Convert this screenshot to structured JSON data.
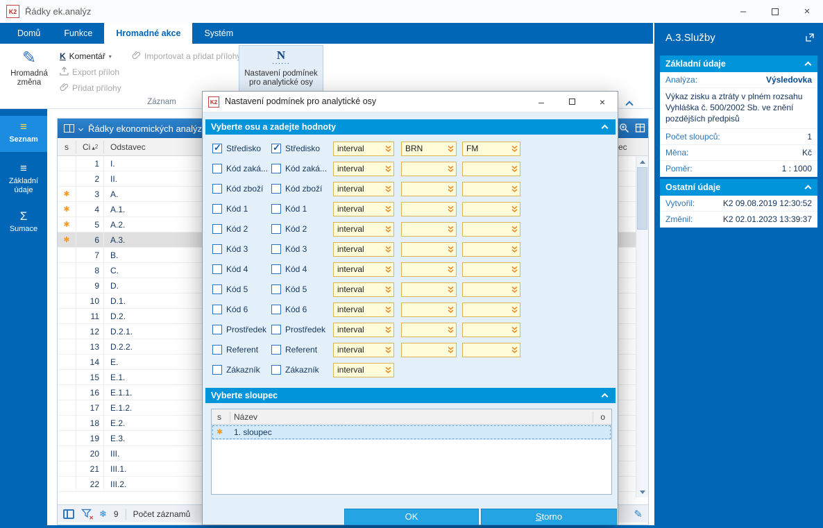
{
  "colors": {
    "accent_blue": "#0066b5",
    "section_header_blue": "#0094db",
    "field_yellow": "#fffcd9",
    "flag_orange": "#f59a23",
    "selection_gray": "#e0e0e0"
  },
  "window_controls": {
    "minimize": "–",
    "close": "×"
  },
  "titlebar": {
    "app_icon": "K2",
    "title": "Řádky ek.analýz"
  },
  "ribbon": {
    "tabs": [
      {
        "label": "Domů",
        "active": false
      },
      {
        "label": "Funkce",
        "active": false
      },
      {
        "label": "Hromadné akce",
        "active": true
      },
      {
        "label": "Systém",
        "active": false
      }
    ],
    "bulk_change_label": "Hromadná změna",
    "comment_key": "K",
    "comment_label": "Komentář",
    "export_attachments_label": "Export příloh",
    "add_attachments_label": "Přidat přílohy",
    "import_attachments_label": "Importovat a přidat přílohy",
    "axis_settings_icon": "N",
    "axis_settings_label": "Nastavení podmínek pro analytické osy",
    "group_label": "Záznam"
  },
  "sidebar": {
    "items": [
      {
        "label": "Seznam",
        "icon": "list",
        "active": true
      },
      {
        "label": "Základní údaje",
        "icon": "list",
        "active": false
      },
      {
        "label": "Sumace",
        "icon": "sigma",
        "active": false
      }
    ]
  },
  "grid": {
    "title": "Řádky ekonomických analýz",
    "columns": {
      "s": "s",
      "ci": "Ci",
      "ci_sort_order": "2",
      "odstavec": "Odstavec",
      "partial_right": "ec"
    },
    "rows": [
      {
        "ci": "1",
        "odstavec": "I.",
        "flag": false,
        "selected": false
      },
      {
        "ci": "2",
        "odstavec": "II.",
        "flag": false,
        "selected": false
      },
      {
        "ci": "3",
        "odstavec": "A.",
        "flag": true,
        "selected": false
      },
      {
        "ci": "4",
        "odstavec": "A.1.",
        "flag": true,
        "selected": false
      },
      {
        "ci": "5",
        "odstavec": "A.2.",
        "flag": true,
        "selected": false
      },
      {
        "ci": "6",
        "odstavec": "A.3.",
        "flag": true,
        "selected": true
      },
      {
        "ci": "7",
        "odstavec": "B.",
        "flag": false,
        "selected": false
      },
      {
        "ci": "8",
        "odstavec": "C.",
        "flag": false,
        "selected": false
      },
      {
        "ci": "9",
        "odstavec": "D.",
        "flag": false,
        "selected": false
      },
      {
        "ci": "10",
        "odstavec": "D.1.",
        "flag": false,
        "selected": false
      },
      {
        "ci": "11",
        "odstavec": "D.2.",
        "flag": false,
        "selected": false
      },
      {
        "ci": "12",
        "odstavec": "D.2.1.",
        "flag": false,
        "selected": false
      },
      {
        "ci": "13",
        "odstavec": "D.2.2.",
        "flag": false,
        "selected": false
      },
      {
        "ci": "14",
        "odstavec": "E.",
        "flag": false,
        "selected": false
      },
      {
        "ci": "15",
        "odstavec": "E.1.",
        "flag": false,
        "selected": false
      },
      {
        "ci": "16",
        "odstavec": "E.1.1.",
        "flag": false,
        "selected": false
      },
      {
        "ci": "17",
        "odstavec": "E.1.2.",
        "flag": false,
        "selected": false
      },
      {
        "ci": "18",
        "odstavec": "E.2.",
        "flag": false,
        "selected": false
      },
      {
        "ci": "19",
        "odstavec": "E.3.",
        "flag": false,
        "selected": false
      },
      {
        "ci": "20",
        "odstavec": "III.",
        "flag": false,
        "selected": false
      },
      {
        "ci": "21",
        "odstavec": "III.1.",
        "flag": false,
        "selected": false
      },
      {
        "ci": "22",
        "odstavec": "III.2.",
        "flag": false,
        "selected": false
      }
    ],
    "status": {
      "count": "9",
      "count_label": "Počet záznamů"
    }
  },
  "detail": {
    "title": "A.3.Služby",
    "sections": [
      {
        "title": "Základní údaje",
        "rows": [
          {
            "type": "pair",
            "label": "Analýza:",
            "value": "Výsledovka",
            "strong": true
          },
          {
            "type": "text",
            "text": "Výkaz zisku a ztráty v plném rozsahu Vyhláška č. 500/2002 Sb. ve znění pozdějších předpisů"
          },
          {
            "type": "pair",
            "label": "Počet sloupců:",
            "value": "1",
            "strong": false
          },
          {
            "type": "pair",
            "label": "Měna:",
            "value": "Kč",
            "strong": false
          },
          {
            "type": "pair",
            "label": "Poměr:",
            "value": "1 : 1000",
            "strong": false
          }
        ]
      },
      {
        "title": "Ostatní údaje",
        "rows": [
          {
            "type": "pair",
            "label": "Vytvořil:",
            "value": "K2 09.08.2019 12:30:52",
            "strong": false
          },
          {
            "type": "pair",
            "label": "Změnil:",
            "value": "K2 02.01.2023 13:39:37",
            "strong": false
          }
        ]
      }
    ]
  },
  "dialog": {
    "title": "Nastavení podmínek pro analytické osy",
    "axes_section": {
      "title": "Vyberte osu a zadejte hodnoty",
      "rows": [
        {
          "label1": "Středisko",
          "label2": "Středisko",
          "checked1": true,
          "checked2": true,
          "operator": "interval",
          "from": "BRN",
          "to": "FM",
          "has_range": true
        },
        {
          "label1": "Kód zaká...",
          "label2": "Kód zaká...",
          "checked1": false,
          "checked2": false,
          "operator": "interval",
          "from": "",
          "to": "",
          "has_range": true
        },
        {
          "label1": "Kód zboží",
          "label2": "Kód zboží",
          "checked1": false,
          "checked2": false,
          "operator": "interval",
          "from": "",
          "to": "",
          "has_range": true
        },
        {
          "label1": "Kód 1",
          "label2": "Kód 1",
          "checked1": false,
          "checked2": false,
          "operator": "interval",
          "from": "",
          "to": "",
          "has_range": true
        },
        {
          "label1": "Kód 2",
          "label2": "Kód 2",
          "checked1": false,
          "checked2": false,
          "operator": "interval",
          "from": "",
          "to": "",
          "has_range": true
        },
        {
          "label1": "Kód 3",
          "label2": "Kód 3",
          "checked1": false,
          "checked2": false,
          "operator": "interval",
          "from": "",
          "to": "",
          "has_range": true
        },
        {
          "label1": "Kód 4",
          "label2": "Kód 4",
          "checked1": false,
          "checked2": false,
          "operator": "interval",
          "from": "",
          "to": "",
          "has_range": true
        },
        {
          "label1": "Kód 5",
          "label2": "Kód 5",
          "checked1": false,
          "checked2": false,
          "operator": "interval",
          "from": "",
          "to": "",
          "has_range": true
        },
        {
          "label1": "Kód 6",
          "label2": "Kód 6",
          "checked1": false,
          "checked2": false,
          "operator": "interval",
          "from": "",
          "to": "",
          "has_range": true
        },
        {
          "label1": "Prostředek",
          "label2": "Prostředek",
          "checked1": false,
          "checked2": false,
          "operator": "interval",
          "from": "",
          "to": "",
          "has_range": true
        },
        {
          "label1": "Referent",
          "label2": "Referent",
          "checked1": false,
          "checked2": false,
          "operator": "interval",
          "from": "",
          "to": "",
          "has_range": true
        },
        {
          "label1": "Zákazník",
          "label2": "Zákazník",
          "checked1": false,
          "checked2": false,
          "operator": "interval",
          "from": "",
          "to": "",
          "has_range": false
        }
      ]
    },
    "column_section": {
      "title": "Vyberte sloupec",
      "columns": {
        "s": "s",
        "name": "Název",
        "o": "o"
      },
      "rows": [
        {
          "name": "1. sloupec",
          "flag": true,
          "selected": true
        }
      ]
    },
    "ok_label": "OK",
    "cancel_label": "Storno"
  }
}
